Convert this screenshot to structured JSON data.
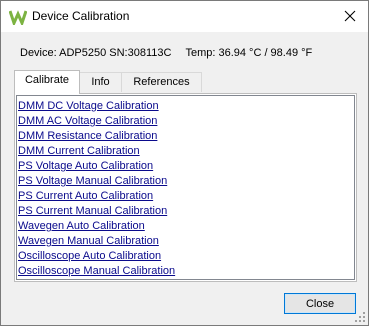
{
  "window": {
    "title": "Device Calibration",
    "icon": "waveforms-logo-icon",
    "accent_color": "#0078d7"
  },
  "device_info": {
    "device": "Device: ADP5250 SN:308113C",
    "temperature": "Temp: 36.94 °C / 98.49 °F"
  },
  "tabs": [
    {
      "label": "Calibrate",
      "active": true
    },
    {
      "label": "Info",
      "active": false
    },
    {
      "label": "References",
      "active": false
    }
  ],
  "calibrations": [
    "DMM DC Voltage Calibration",
    "DMM AC Voltage Calibration",
    "DMM Resistance Calibration",
    "DMM Current Calibration",
    "PS Voltage Auto Calibration",
    "PS Voltage Manual Calibration",
    "PS Current Auto Calibration",
    "PS Current Manual Calibration",
    "Wavegen Auto Calibration",
    "Wavegen Manual Calibration",
    "Oscilloscope Auto Calibration",
    "Oscilloscope Manual Calibration"
  ],
  "buttons": {
    "close": "Close"
  }
}
